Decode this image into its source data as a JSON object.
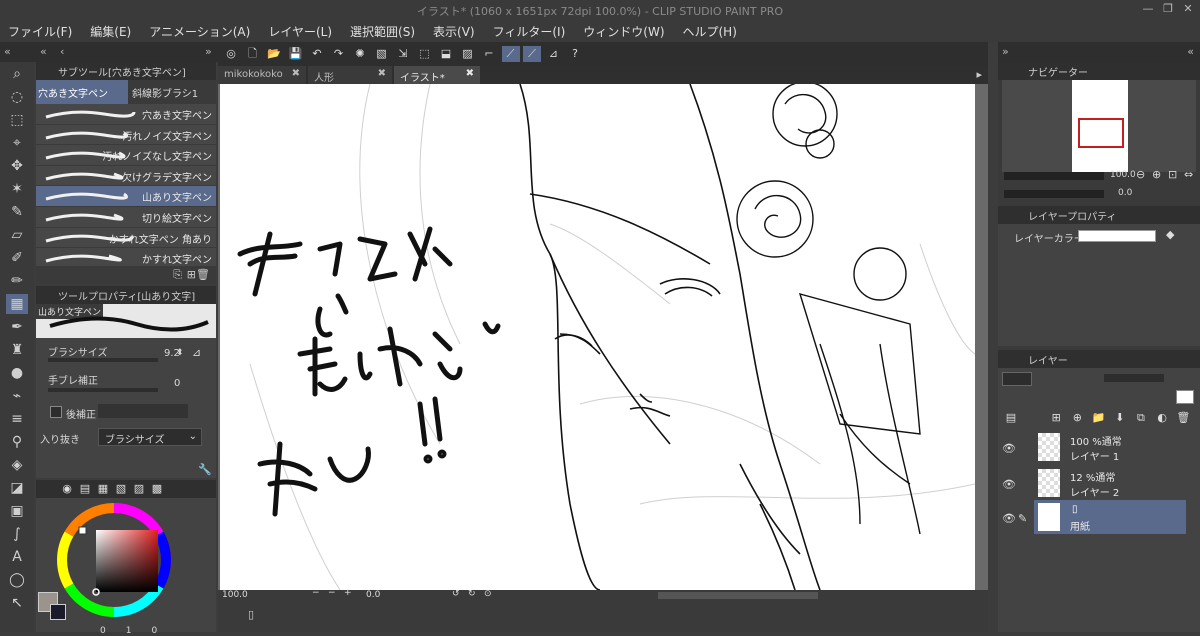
{
  "app": {
    "title": "イラスト* (1060 x 1651px 72dpi 100.0%)  - CLIP STUDIO PAINT PRO"
  },
  "menu": [
    "ファイル(F)",
    "編集(E)",
    "アニメーション(A)",
    "レイヤー(L)",
    "選択範囲(S)",
    "表示(V)",
    "フィルター(I)",
    "ウィンドウ(W)",
    "ヘルプ(H)"
  ],
  "doc_tabs": [
    "mikokokoko",
    "人形",
    "イラスト*"
  ],
  "subtool": {
    "header": "サブツール[穴あき文字ペン]",
    "tab_active": "穴あき文字ペン",
    "tab_other": "斜線影ブラシ1",
    "brushes": [
      "穴あき文字ペン",
      "汚れノイズ文字ペン",
      "汚れノイズなし文字ペン",
      "欠けグラデ文字ペン",
      "山あり文字ペン",
      "切り絵文字ペン",
      "かすれ文字ペン 角あり",
      "かすれ文字ペン"
    ],
    "selected_index": 4
  },
  "toolprop": {
    "header": "ツールプロパティ[山あり文字]",
    "preview_label": "山あり文字ペン",
    "brush_size_label": "ブラシサイズ",
    "brush_size_value": "9.2",
    "stabilization_label": "手ブレ補正",
    "stabilization_value": "0",
    "post_correction_label": "後補正",
    "taper_label": "入り抜き",
    "taper_value": "ブラシサイズ"
  },
  "statusbar": {
    "zoom": "100.0",
    "rotation": "0.0"
  },
  "navigator": {
    "header": "ナビゲーター",
    "zoom": "100.0",
    "rotation": "0.0"
  },
  "layer_property": {
    "header": "レイヤープロパティ",
    "color_label": "レイヤーカラー"
  },
  "layers": {
    "header": "レイヤー",
    "rows": [
      {
        "line1": "100 %通常",
        "line2": "レイヤー 1"
      },
      {
        "line1": "12 %通常",
        "line2": "レイヤー 2"
      },
      {
        "line1": "",
        "line2": "用紙"
      }
    ]
  },
  "colors": {
    "accent_selected": "#5a6a8c",
    "main_color": "#9a948d",
    "sub_color": "#1a1a2a"
  },
  "color_values": {
    "left": "0",
    "mid": "0",
    "right": "1",
    "far": "0"
  }
}
